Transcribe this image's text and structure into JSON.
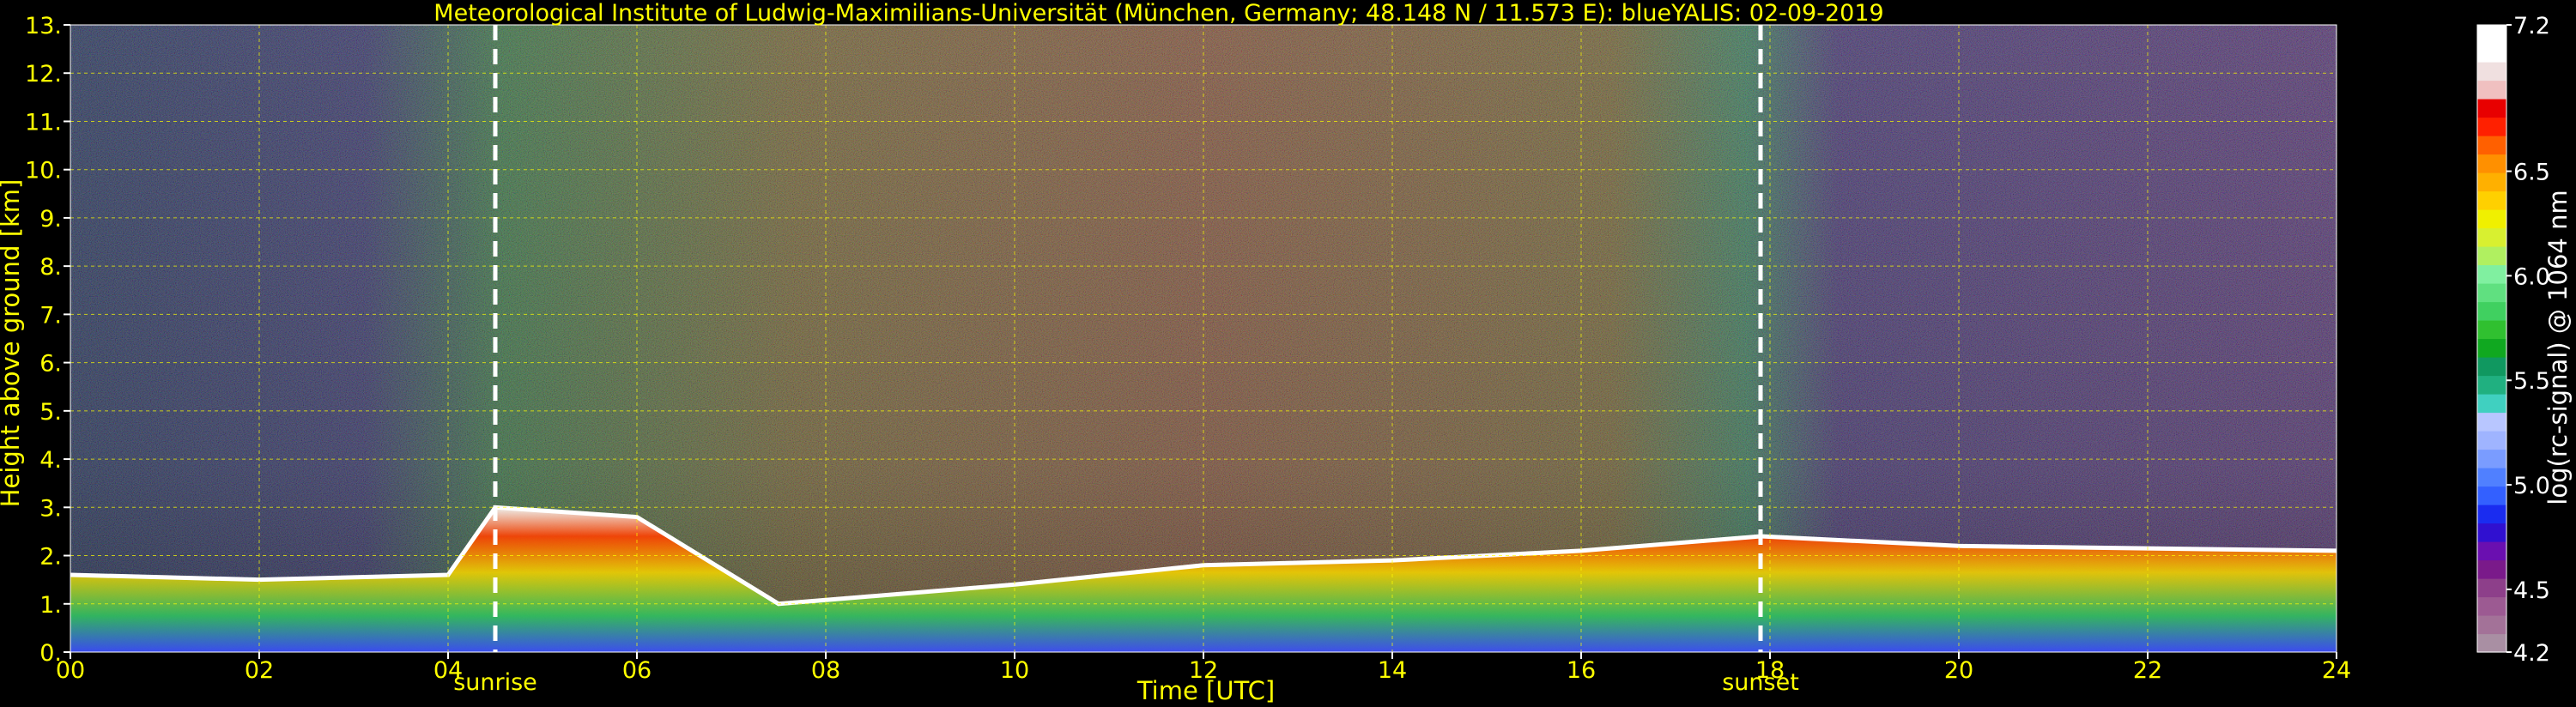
{
  "chart_data": {
    "type": "heatmap",
    "title": "Meteorological Institute of Ludwig-Maximilians-Universität (München, Germany; 48.148 N / 11.573 E):     blueYALIS: 02-09-2019",
    "xlabel": "Time [UTC]",
    "ylabel": "Height above ground [km]",
    "xlim": [
      0,
      24
    ],
    "ylim": [
      0,
      13
    ],
    "x_ticks": [
      "00",
      "02",
      "04",
      "06",
      "08",
      "10",
      "12",
      "14",
      "16",
      "18",
      "20",
      "22",
      "24"
    ],
    "y_ticks": [
      "0.",
      "1.",
      "2.",
      "3.",
      "4.",
      "5.",
      "6.",
      "7.",
      "8.",
      "9.",
      "10.",
      "11.",
      "12.",
      "13."
    ],
    "grid": true,
    "markers": [
      {
        "label": "sunrise",
        "x": 4.5
      },
      {
        "label": "sunset",
        "x": 17.9
      }
    ],
    "colorbar": {
      "label": "log(rc-signal) @ 1064 nm",
      "range": [
        4.2,
        7.2
      ],
      "tick_labels": [
        "7.2",
        "6.5",
        "6.0",
        "5.5",
        "5.0",
        "4.5",
        "4.2"
      ],
      "tick_values": [
        7.2,
        6.5,
        6.0,
        5.5,
        5.0,
        4.5,
        4.2
      ],
      "colors": [
        "#a98fa3",
        "#a37298",
        "#9c5a92",
        "#8d3f8a",
        "#7a1a8a",
        "#6a0fb0",
        "#3010d0",
        "#1a2cf0",
        "#3360ff",
        "#5080ff",
        "#7a9cff",
        "#9fb4ff",
        "#b8c6ff",
        "#40d0c0",
        "#20b080",
        "#109860",
        "#10a820",
        "#30c030",
        "#40d060",
        "#60e080",
        "#80f0a0",
        "#b0f060",
        "#d8f030",
        "#f0f000",
        "#ffd000",
        "#ffb000",
        "#ff9000",
        "#ff6000",
        "#ff2000",
        "#e80000",
        "#f0c0c0",
        "#f0e0e0",
        "#ffffff",
        "#ffffff"
      ]
    },
    "layer_top_km": [
      {
        "x": 0.0,
        "y": 1.6
      },
      {
        "x": 2.0,
        "y": 1.5
      },
      {
        "x": 4.0,
        "y": 1.6
      },
      {
        "x": 4.5,
        "y": 3.0
      },
      {
        "x": 6.0,
        "y": 2.8
      },
      {
        "x": 7.5,
        "y": 1.0
      },
      {
        "x": 10.0,
        "y": 1.4
      },
      {
        "x": 12.0,
        "y": 1.8
      },
      {
        "x": 14.0,
        "y": 1.9
      },
      {
        "x": 16.0,
        "y": 2.1
      },
      {
        "x": 17.9,
        "y": 2.4
      },
      {
        "x": 20.0,
        "y": 2.2
      },
      {
        "x": 24.0,
        "y": 2.1
      }
    ]
  }
}
